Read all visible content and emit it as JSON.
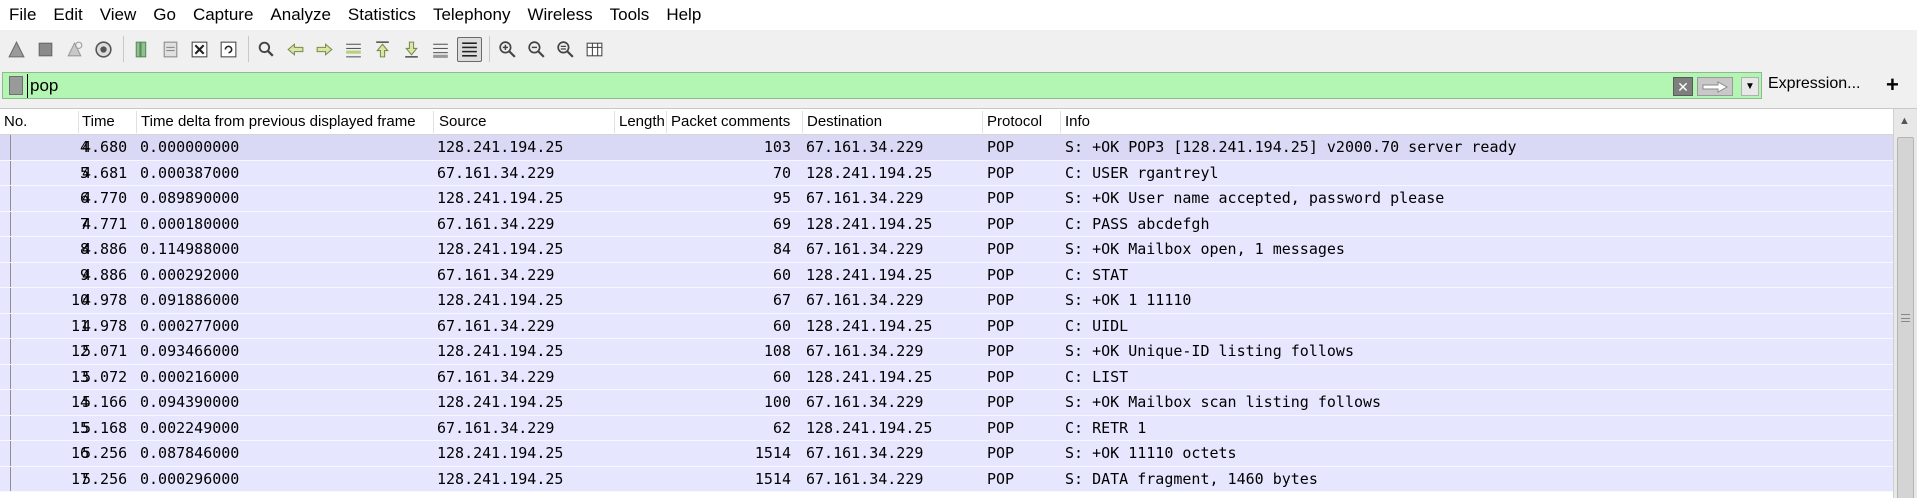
{
  "menu": [
    "File",
    "Edit",
    "View",
    "Go",
    "Capture",
    "Analyze",
    "Statistics",
    "Telephony",
    "Wireless",
    "Tools",
    "Help"
  ],
  "toolbar": {
    "icons": [
      "start-capture-icon",
      "stop-capture-icon",
      "restart-capture-icon",
      "capture-options-icon",
      "open-file-icon",
      "save-file-icon",
      "close-file-icon",
      "reload-file-icon",
      "find-packet-icon",
      "go-back-icon",
      "go-forward-icon",
      "go-to-packet-icon",
      "go-first-icon",
      "go-last-icon",
      "auto-scroll-icon",
      "colorize-icon",
      "zoom-in-icon",
      "zoom-out-icon",
      "normal-size-icon",
      "resize-columns-icon"
    ]
  },
  "filter": {
    "value": "pop",
    "expression_label": "Expression...",
    "add_label": "+",
    "background_color": "#b3f5b3"
  },
  "columns": [
    "No.",
    "Time",
    "Time delta from previous displayed frame",
    "Source",
    "Length",
    "Packet comments",
    "Destination",
    "Protocol",
    "Info"
  ],
  "packets": [
    {
      "no": "4",
      "time": "4.680",
      "delta": "0.000000000",
      "source": "128.241.194.25",
      "length": "103",
      "comments": "",
      "destination": "67.161.34.229",
      "protocol": "POP",
      "info": "S: +OK POP3 [128.241.194.25] v2000.70 server ready"
    },
    {
      "no": "5",
      "time": "4.681",
      "delta": "0.000387000",
      "source": "67.161.34.229",
      "length": "70",
      "comments": "",
      "destination": "128.241.194.25",
      "protocol": "POP",
      "info": "C: USER rgantreyl"
    },
    {
      "no": "6",
      "time": "4.770",
      "delta": "0.089890000",
      "source": "128.241.194.25",
      "length": "95",
      "comments": "",
      "destination": "67.161.34.229",
      "protocol": "POP",
      "info": "S: +OK User name accepted, password please"
    },
    {
      "no": "7",
      "time": "4.771",
      "delta": "0.000180000",
      "source": "67.161.34.229",
      "length": "69",
      "comments": "",
      "destination": "128.241.194.25",
      "protocol": "POP",
      "info": "C: PASS abcdefgh"
    },
    {
      "no": "8",
      "time": "4.886",
      "delta": "0.114988000",
      "source": "128.241.194.25",
      "length": "84",
      "comments": "",
      "destination": "67.161.34.229",
      "protocol": "POP",
      "info": "S: +OK Mailbox open, 1 messages"
    },
    {
      "no": "9",
      "time": "4.886",
      "delta": "0.000292000",
      "source": "67.161.34.229",
      "length": "60",
      "comments": "",
      "destination": "128.241.194.25",
      "protocol": "POP",
      "info": "C: STAT"
    },
    {
      "no": "10",
      "time": "4.978",
      "delta": "0.091886000",
      "source": "128.241.194.25",
      "length": "67",
      "comments": "",
      "destination": "67.161.34.229",
      "protocol": "POP",
      "info": "S: +OK 1 11110"
    },
    {
      "no": "11",
      "time": "4.978",
      "delta": "0.000277000",
      "source": "67.161.34.229",
      "length": "60",
      "comments": "",
      "destination": "128.241.194.25",
      "protocol": "POP",
      "info": "C: UIDL"
    },
    {
      "no": "12",
      "time": "5.071",
      "delta": "0.093466000",
      "source": "128.241.194.25",
      "length": "108",
      "comments": "",
      "destination": "67.161.34.229",
      "protocol": "POP",
      "info": "S: +OK Unique-ID listing follows"
    },
    {
      "no": "13",
      "time": "5.072",
      "delta": "0.000216000",
      "source": "67.161.34.229",
      "length": "60",
      "comments": "",
      "destination": "128.241.194.25",
      "protocol": "POP",
      "info": "C: LIST"
    },
    {
      "no": "14",
      "time": "5.166",
      "delta": "0.094390000",
      "source": "128.241.194.25",
      "length": "100",
      "comments": "",
      "destination": "67.161.34.229",
      "protocol": "POP",
      "info": "S: +OK Mailbox scan listing follows"
    },
    {
      "no": "15",
      "time": "5.168",
      "delta": "0.002249000",
      "source": "67.161.34.229",
      "length": "62",
      "comments": "",
      "destination": "128.241.194.25",
      "protocol": "POP",
      "info": "C: RETR 1"
    },
    {
      "no": "16",
      "time": "5.256",
      "delta": "0.087846000",
      "source": "128.241.194.25",
      "length": "1514",
      "comments": "",
      "destination": "67.161.34.229",
      "protocol": "POP",
      "info": "S: +OK 11110 octets"
    },
    {
      "no": "17",
      "time": "5.256",
      "delta": "0.000296000",
      "source": "128.241.194.25",
      "length": "1514",
      "comments": "",
      "destination": "67.161.34.229",
      "protocol": "POP",
      "info": "S: DATA fragment, 1460 bytes"
    }
  ],
  "colors": {
    "row_background": "#e7e6ff",
    "filter_valid": "#b3f5b3"
  }
}
